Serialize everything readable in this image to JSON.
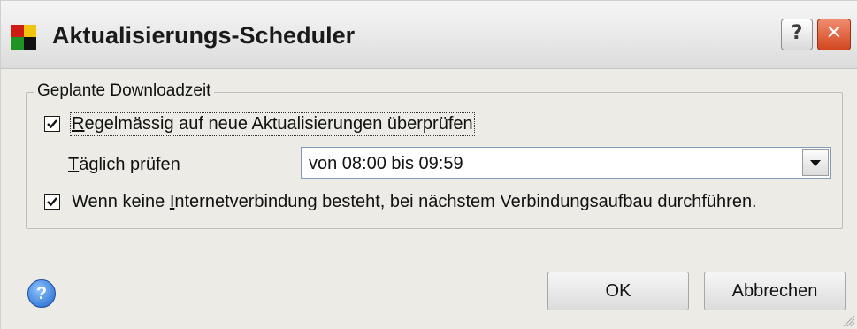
{
  "window": {
    "title": "Aktualisierungs-Scheduler",
    "icon": "app-logo-icon",
    "help_glyph": "?",
    "close_glyph": "✕"
  },
  "group": {
    "legend": "Geplante Downloadzeit",
    "check_regular": {
      "checked": true,
      "mnemonic": "R",
      "label_rest": "egelmässig auf neue Aktualisierungen überprüfen"
    },
    "daily": {
      "mnemonic": "T",
      "label_rest": "äglich prüfen",
      "selected": "von 08:00 bis 09:59"
    },
    "check_offline": {
      "checked": true,
      "label_before": "Wenn keine ",
      "mnemonic": "I",
      "label_after": "nternetverbindung besteht, bei nächstem Verbindungsaufbau durchführen."
    }
  },
  "buttons": {
    "ok": "OK",
    "cancel": "Abbrechen",
    "help_glyph": "?"
  },
  "colors": {
    "dialog_bg": "#ecebe6",
    "close_red": "#d2471f",
    "help_blue": "#1f63c8"
  }
}
